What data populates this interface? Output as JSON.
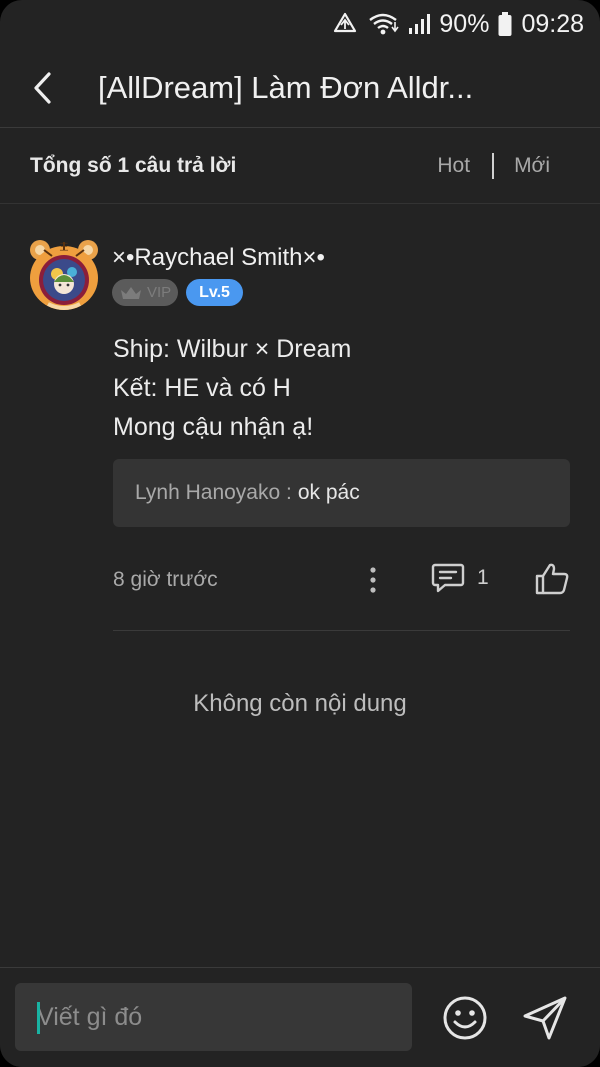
{
  "status_bar": {
    "battery": "90%",
    "time": "09:28",
    "icons": [
      "data-saver-icon",
      "wifi-icon",
      "signal-icon",
      "battery-icon"
    ]
  },
  "header": {
    "back_icon": "chevron-left-icon",
    "title": "[AllDream] Làm Đơn Alldr..."
  },
  "summary": {
    "count_label": "Tổng số 1 câu trả lời",
    "sort_hot": "Hot",
    "sort_new": "Mới"
  },
  "comment": {
    "user_name": "×•Raychael Smith×•",
    "vip_label": "VIP",
    "level_label": "Lv.5",
    "lines": [
      "Ship: Wilbur × Dream",
      "Kết: HE và có H",
      "Mong cậu nhận ạ!"
    ],
    "reply": {
      "author": "Lynh Hanoyako :",
      "text": "ok pác"
    },
    "time": "8 giờ trước",
    "reply_count": "1"
  },
  "end_label": "Không còn nội dung",
  "composer": {
    "placeholder": "Viết gì đó",
    "emoji_icon": "smiley-icon",
    "send_icon": "send-icon"
  },
  "colors": {
    "background": "#232323",
    "level_badge": "#4a98f0",
    "vip_badge": "#5b5b5b",
    "caret": "#19b3a3"
  }
}
